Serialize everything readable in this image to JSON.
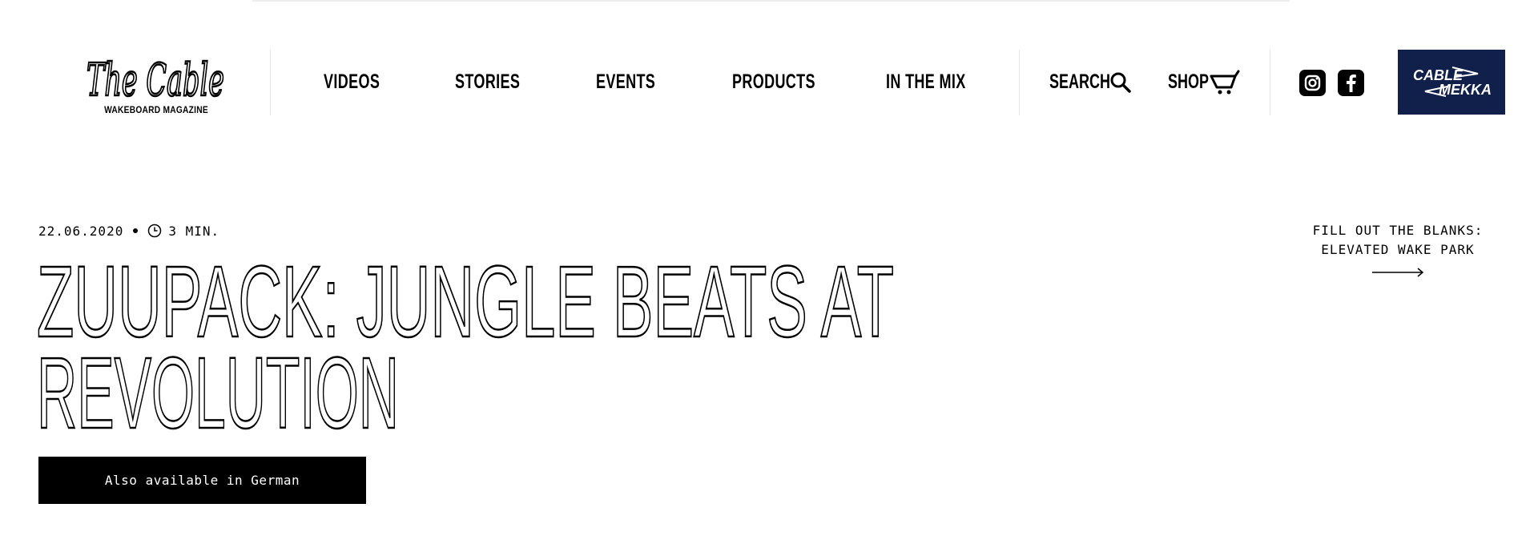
{
  "header": {
    "logo": {
      "script": "The Cable",
      "tagline": "WAKEBOARD MAGAZINE"
    },
    "nav": [
      "VIDEOS",
      "STORIES",
      "EVENTS",
      "PRODUCTS",
      "IN THE MIX"
    ],
    "search_label": "SEARCH",
    "shop_label": "SHOP",
    "social": {
      "instagram": "instagram-icon",
      "facebook": "facebook-icon"
    },
    "partner": {
      "line1": "CABLE",
      "line2": "MEKKA",
      "bg": "#10204a"
    }
  },
  "article": {
    "date": "22.06.2020",
    "read_time": "3 MIN.",
    "title_line1": "ZUUPACK: JUNGLE BEATS AT",
    "title_line2": "REVOLUTION",
    "language_button": "Also available in German"
  },
  "related": {
    "line1": "FILL OUT THE BLANKS:",
    "line2": "ELEVATED WAKE PARK"
  }
}
